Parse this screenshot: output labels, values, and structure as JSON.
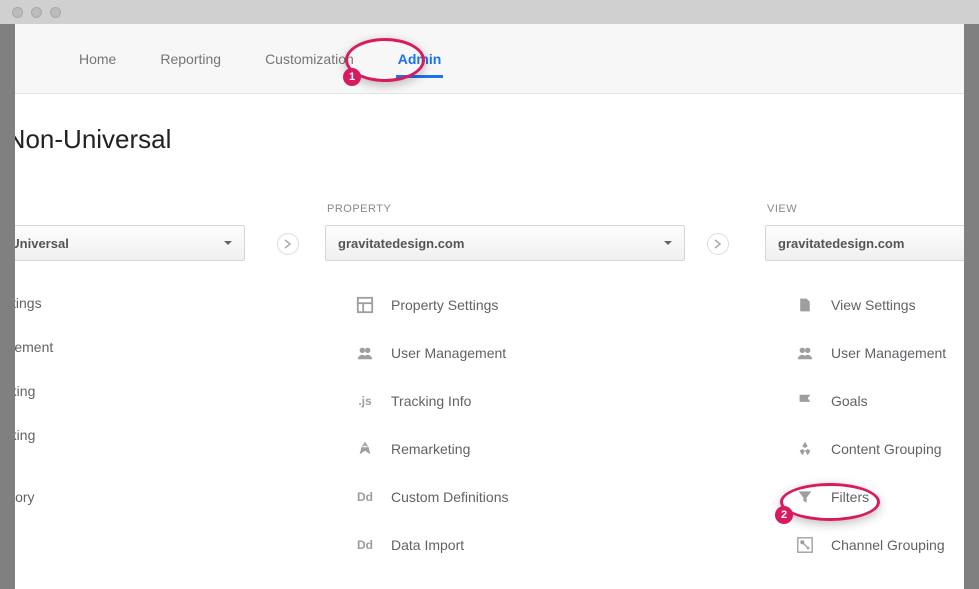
{
  "nav": {
    "home": "Home",
    "reporting": "Reporting",
    "customization": "Customization",
    "admin": "Admin"
  },
  "page_title_fragment": "e Non-Universal",
  "columns": {
    "account": {
      "selector_fragment": "n-Universal",
      "items": [
        "Settings",
        "nagement",
        "Linking",
        "Linking",
        "History"
      ]
    },
    "property": {
      "label": "PROPERTY",
      "selector": "gravitatedesign.com",
      "items": [
        "Property Settings",
        "User Management",
        "Tracking Info",
        "Remarketing",
        "Custom Definitions",
        "Data Import"
      ]
    },
    "view": {
      "label": "VIEW",
      "selector": "gravitatedesign.com",
      "items": [
        "View Settings",
        "User Management",
        "Goals",
        "Content Grouping",
        "Filters",
        "Channel Grouping"
      ]
    }
  },
  "annotations": {
    "badge1": "1",
    "badge2": "2"
  }
}
